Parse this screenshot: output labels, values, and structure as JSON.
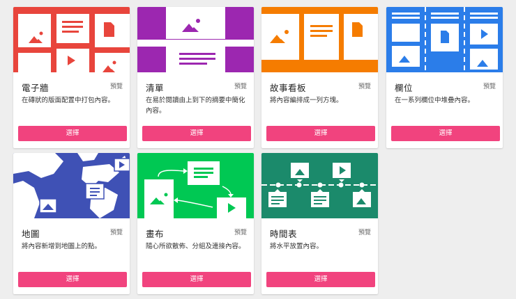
{
  "cards": [
    {
      "title": "電子牆",
      "preview": "預覽",
      "desc": "在磚狀的版面配置中打包內容。",
      "button": "選擇",
      "color": "#e8453c",
      "icon": "wall-icon"
    },
    {
      "title": "清單",
      "preview": "預覽",
      "desc": "在易於閱讀由上到下的摘要中簡化內容。",
      "button": "選擇",
      "color": "#9c27b0",
      "icon": "list-icon"
    },
    {
      "title": "故事看板",
      "preview": "預覽",
      "desc": "將內容編排成一列方塊。",
      "button": "選擇",
      "color": "#f57c00",
      "icon": "storyboard-icon"
    },
    {
      "title": "欄位",
      "preview": "預覽",
      "desc": "在一系列欄位中堆疊內容。",
      "button": "選擇",
      "color": "#2b7de9",
      "icon": "columns-icon"
    },
    {
      "title": "地圖",
      "preview": "預覽",
      "desc": "將內容新增到地圖上的點。",
      "button": "選擇",
      "color": "#3f51b5",
      "icon": "map-icon"
    },
    {
      "title": "畫布",
      "preview": "預覽",
      "desc": "隨心所欲散佈、分組及連接內容。",
      "button": "選擇",
      "color": "#00c853",
      "icon": "canvas-icon"
    },
    {
      "title": "時間表",
      "preview": "預覽",
      "desc": "將水平放置內容。",
      "button": "選擇",
      "color": "#1b8a6b",
      "icon": "timeline-icon"
    }
  ]
}
